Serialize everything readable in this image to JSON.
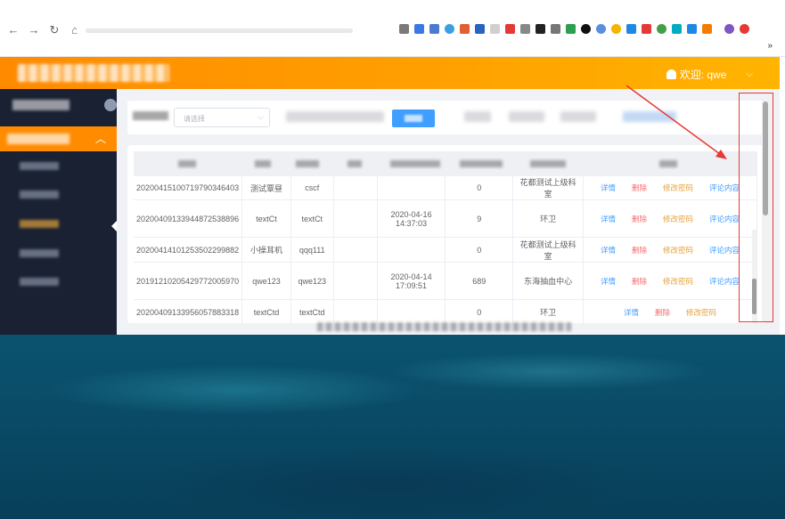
{
  "browser": {
    "nav_icons": [
      "back-icon",
      "forward-icon",
      "reload-icon",
      "home-icon"
    ],
    "extensions_more": "»"
  },
  "header": {
    "welcome": "欢迎: qwe",
    "dropdown_icon": "chevron-down-icon"
  },
  "filter": {
    "select_placeholder": "请选择"
  },
  "table": {
    "rows": [
      {
        "id": "20200415100719790346403",
        "name": "测试覃昼",
        "account": "cscf",
        "time": "",
        "count": "0",
        "unit": "花都测试上级科室"
      },
      {
        "id": "20200409133944872538896",
        "name": "textCt",
        "account": "textCt",
        "time": "2020-04-16 14:37:03",
        "count": "9",
        "unit": "环卫"
      },
      {
        "id": "20200414101253502299882",
        "name": "小操耳机",
        "account": "qqq111",
        "time": "",
        "count": "0",
        "unit": "花都测试上级科室"
      },
      {
        "id": "20191210205429772005970",
        "name": "qwe123",
        "account": "qwe123",
        "time": "2020-04-14 17:09:51",
        "count": "689",
        "unit": "东海抽血中心"
      },
      {
        "id": "20200409133956057883318",
        "name": "textCtd",
        "account": "textCtd",
        "time": "",
        "count": "0",
        "unit": "环卫"
      }
    ],
    "ops": {
      "detail": "详情",
      "delete": "删除",
      "change_password": "修改密码",
      "comments": "评论内容"
    }
  },
  "colors": {
    "accent": "#ff8c00",
    "sidebar": "#192132",
    "link": "#409eff",
    "danger": "#f56c6c",
    "warning": "#e6a23c",
    "annotation": "#e53935"
  }
}
